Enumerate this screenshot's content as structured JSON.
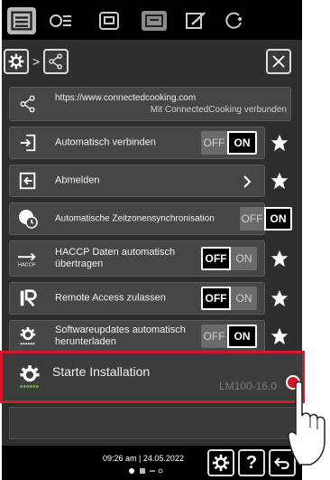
{
  "tabs": [
    {
      "name": "menu-icon"
    },
    {
      "name": "settings-list-icon"
    },
    {
      "name": "oven-icon"
    },
    {
      "name": "tray-icon"
    },
    {
      "name": "edit-icon"
    },
    {
      "name": "connect-icon"
    }
  ],
  "header": {
    "separator": ">"
  },
  "connection": {
    "url": "https://www.connectedcooking.com",
    "status": "Mit ConnectedCooking verbunden"
  },
  "rows": [
    {
      "label": "Automatisch verbinden",
      "off": "OFF",
      "on": "ON",
      "state": "on"
    },
    {
      "label": "Abmelden"
    },
    {
      "label": "Automatische Zeitzonensynchronisation",
      "off": "OFF",
      "on": "ON",
      "state": "on"
    },
    {
      "label": "HACCP Daten automatisch übertragen",
      "off": "OFF",
      "on": "ON",
      "state": "off"
    },
    {
      "label": "Remote Access zulassen",
      "off": "OFF",
      "on": "ON",
      "state": "off"
    },
    {
      "label": "Softwareupdates automatisch herunterladen",
      "off": "OFF",
      "on": "ON",
      "state": "on"
    }
  ],
  "install": {
    "label": "Starte Installation",
    "version": "LM100-16.0"
  },
  "footer": {
    "time": "09:26 am | 24.05.2022",
    "help": "?"
  },
  "colors": {
    "accent_red": "#d6172a",
    "background": "#2e2e2e"
  }
}
